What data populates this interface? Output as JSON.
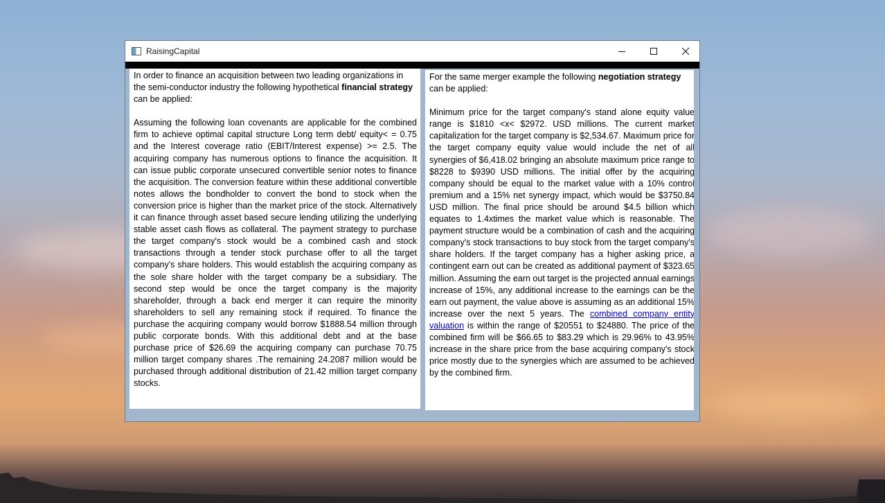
{
  "window": {
    "title": "RaisingCapital",
    "controls": {
      "minimize": "—",
      "maximize": "☐",
      "close": "✕"
    }
  },
  "left_panel": {
    "intro_before": "In order to finance an acquisition between two leading organizations in the semi-conductor industry the following hypothetical ",
    "intro_bold": "financial strategy",
    "intro_after": "  can be applied:",
    "body": "Assuming the following loan covenants are applicable for the combined firm to achieve optimal capital structure Long term debt/ equity< = 0.75 and the Interest coverage ratio (EBIT/Interest expense) >= 2.5. The acquiring company has numerous options to finance the acquisition. It can issue public corporate unsecured convertible senior notes to finance the acquisition. The conversion feature within these additional convertible notes allows the bondholder to convert the bond to stock when the conversion price is higher than the market price of the stock. Alternatively it can finance through asset based secure lending utilizing the underlying stable asset cash flows as collateral.  The payment strategy to purchase the target company's stock would be a combined cash and stock transactions through a tender stock purchase offer to all the target company's share holders. This would establish the acquiring company as the sole share holder with the target company be a subsidiary. The second step would be once the target company is the majority shareholder, through a back end merger it can require the minority shareholders to sell any remaining stock if required. To finance the purchase the acquiring company would borrow $1888.54 million through public corporate bonds. With this additional debt and at the base purchase price of $26.69 the acquiring company can purchase 70.75 million target company shares .The remaining 24.2087 million would be purchased through additional distribution of 21.42 million target company stocks."
  },
  "right_panel": {
    "intro_before": "For the same merger example the following  ",
    "intro_bold": "negotiation strategy",
    "intro_after": " can be applied:",
    "body_before": "Minimum price for the target company's stand alone equity value range is $1810 <x< $2972. USD millions.  The current market capitalization for the target company is $2,534.67.  Maximum price for the target company equity value would include the net of all synergies of $6,418.02 bringing an absolute maximum price range to $8228 to $9390 USD millions. The initial offer by the acquiring company should be equal to the market value with a 10% control premium and a 15% net synergy impact, which would be $3750.84 USD million. The final price should be around $4.5 billion which equates to 1.4xtimes the market value which is reasonable. The payment structure would be a combination of cash and the acquiring company's stock transactions to buy stock from the target company's share holders.  If the target company has a higher asking price, a contingent  earn out can be created as additional payment of $323.65 million.  Assuming the earn out target is the projected annual earnings increase of 15%, any additional increase to the earnings can be the earn out payment, the value above is assuming as an additional 15% increase over the next 5 years.  The ",
    "link_text": "combined company entity valuation",
    "body_after": "  is within the range of $20551 to $24880. The price of the combined firm will be $66.65 to $83.29 which is 29.96% to 43.95% increase in the share price from the base acquiring company's stock price mostly due to the synergies which are assumed to be achieved by the combined firm."
  }
}
